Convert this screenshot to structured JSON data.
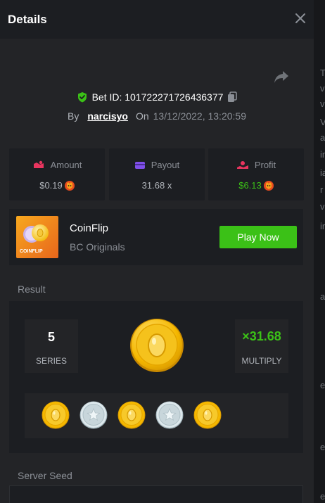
{
  "header": {
    "title": "Details"
  },
  "bet": {
    "id_label": "Bet ID: 101722271726436377",
    "by_label": "By",
    "username": "narcisyo",
    "on_label": "On",
    "datetime": "13/12/2022, 13:20:59"
  },
  "stats": {
    "amount": {
      "label": "Amount",
      "value": "$0.19"
    },
    "payout": {
      "label": "Payout",
      "value": "31.68 x"
    },
    "profit": {
      "label": "Profit",
      "value": "$6.13"
    }
  },
  "game": {
    "name": "CoinFlip",
    "provider": "BC Originals",
    "thumb_text": "COINFLIP",
    "play_label": "Play Now"
  },
  "result": {
    "section_label": "Result",
    "series_value": "5",
    "series_label": "SERIES",
    "multiply_value": "×31.68",
    "multiply_label": "MULTIPLY",
    "coins": [
      "gold",
      "silver",
      "gold",
      "silver",
      "gold"
    ]
  },
  "server_seed": {
    "section_label": "Server Seed"
  },
  "side_strip": [
    "T",
    "v",
    "v",
    "V",
    "a",
    "in",
    "ia",
    "r",
    "v",
    "ir",
    "a",
    "e",
    "e",
    "e"
  ],
  "colors": {
    "accent_green": "#3bc117",
    "panel_bg": "#232427",
    "card_bg": "#1c1e22",
    "muted_text": "#8b8f96"
  },
  "icons": {
    "close": "close-icon",
    "share": "share-icon",
    "verified": "shield-check-icon",
    "copy": "copy-icon",
    "amount": "amount-icon",
    "payout": "payout-icon",
    "profit": "profit-icon",
    "currency": "shib-token-icon"
  }
}
